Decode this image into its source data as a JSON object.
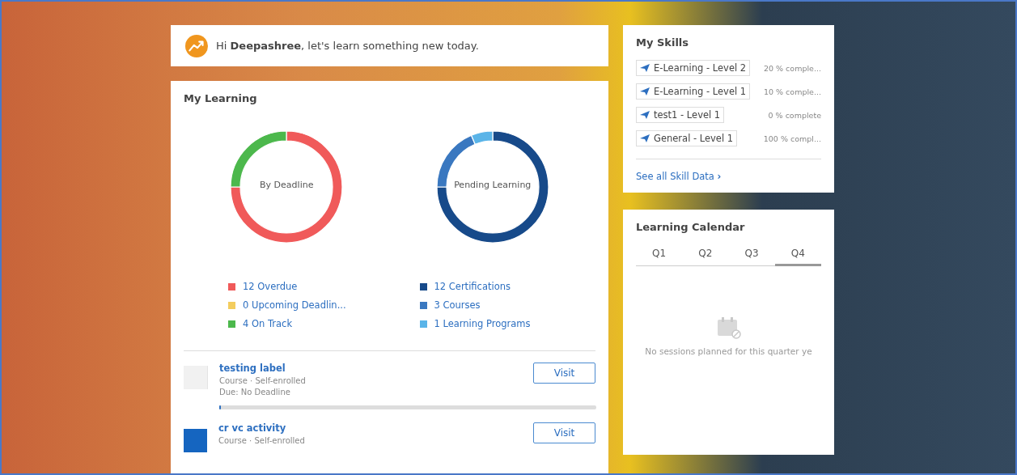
{
  "greeting": {
    "text": "Hi **Deepashree**, let's learn something new today."
  },
  "my_learning": {
    "title": "My Learning",
    "charts": [
      {
        "chart_data": {
          "type": "donut",
          "title": "By Deadline",
          "categories": [
            "12 Overdue",
            "0 Upcoming Deadlin...",
            "4 On Track"
          ],
          "values": [
            12,
            0,
            4
          ]
        },
        "legend": [
          {
            "color": "#f05a5a"
          },
          {
            "color": "#f3cd5e"
          },
          {
            "color": "#4cb84c"
          }
        ]
      },
      {
        "chart_data": {
          "type": "donut",
          "title": "Pending Learning",
          "categories": [
            "12 Certifications",
            "3 Courses",
            "1 Learning Programs"
          ],
          "values": [
            12,
            3,
            1
          ]
        },
        "legend": [
          {
            "color": "#174a8a"
          },
          {
            "color": "#3a78c0"
          },
          {
            "color": "#5ab4e8"
          }
        ]
      }
    ],
    "items": [
      {
        "title": "testing label",
        "meta": "Course · Self-enrolled",
        "due": "Due: No Deadline",
        "kind": "placeholder",
        "button": "Visit",
        "level": 0
      },
      {
        "title": "cr vc activity",
        "meta": "Course · Self-enrolled",
        "kind": "image",
        "button": "Visit"
      }
    ]
  },
  "my_skills": {
    "title": "My Skills",
    "skills": [
      {
        "label": "E-Learning - Level 2",
        "progress": "20 % comple..."
      },
      {
        "label": "E-Learning - Level 1",
        "progress": "10 % comple..."
      },
      {
        "label": "test1 - Level 1",
        "progress": "0 % complete"
      },
      {
        "label": "General - Level 1",
        "progress": "100 % compl..."
      }
    ],
    "link": "See all Skill Data",
    "link_icon": "›"
  },
  "learning_calendar": {
    "title": "Learning Calendar",
    "tabs": [
      {
        "label": "Q1",
        "selected": false
      },
      {
        "label": "Q2",
        "selected": false
      },
      {
        "label": "Q3",
        "selected": false
      },
      {
        "label": "Q4",
        "selected": true
      }
    ],
    "empty_message": "No sessions planned for this quarter ye"
  }
}
